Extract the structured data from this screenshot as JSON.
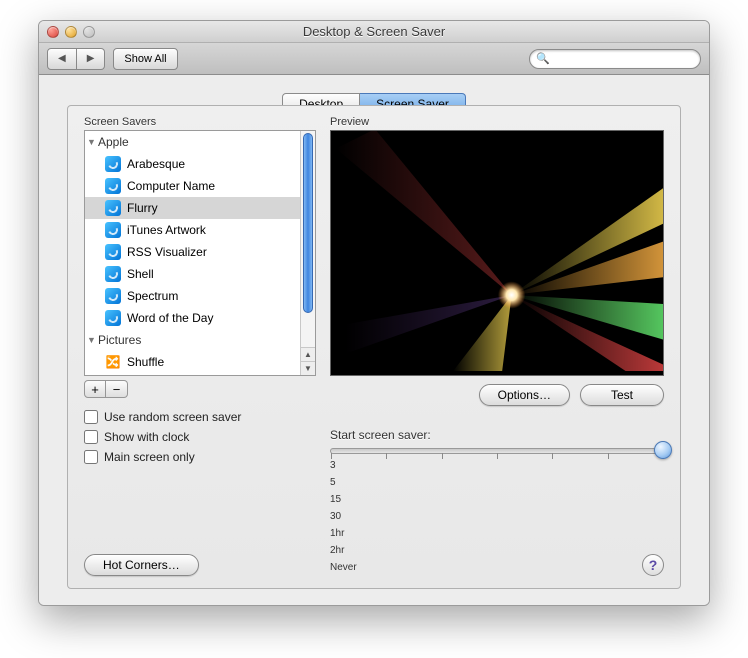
{
  "window": {
    "title": "Desktop & Screen Saver"
  },
  "toolbar": {
    "show_all": "Show All"
  },
  "search": {
    "placeholder": ""
  },
  "tabs": {
    "desktop": "Desktop",
    "screensaver": "Screen Saver"
  },
  "left": {
    "label": "Screen Savers",
    "groups": [
      {
        "name": "Apple",
        "expanded": true,
        "items": [
          "Arabesque",
          "Computer Name",
          "Flurry",
          "iTunes Artwork",
          "RSS Visualizer",
          "Shell",
          "Spectrum",
          "Word of the Day"
        ],
        "selected": "Flurry"
      },
      {
        "name": "Pictures",
        "expanded": true,
        "shuffle": "Shuffle"
      }
    ]
  },
  "checks": {
    "random": "Use random screen saver",
    "clock": "Show with clock",
    "main": "Main screen only"
  },
  "right": {
    "preview_label": "Preview",
    "options": "Options…",
    "test": "Test"
  },
  "slider": {
    "label": "Start screen saver:",
    "ticks": [
      "3",
      "5",
      "15",
      "30",
      "1hr",
      "2hr",
      "Never"
    ],
    "value_index": 6
  },
  "bottom": {
    "hot_corners": "Hot Corners…"
  }
}
